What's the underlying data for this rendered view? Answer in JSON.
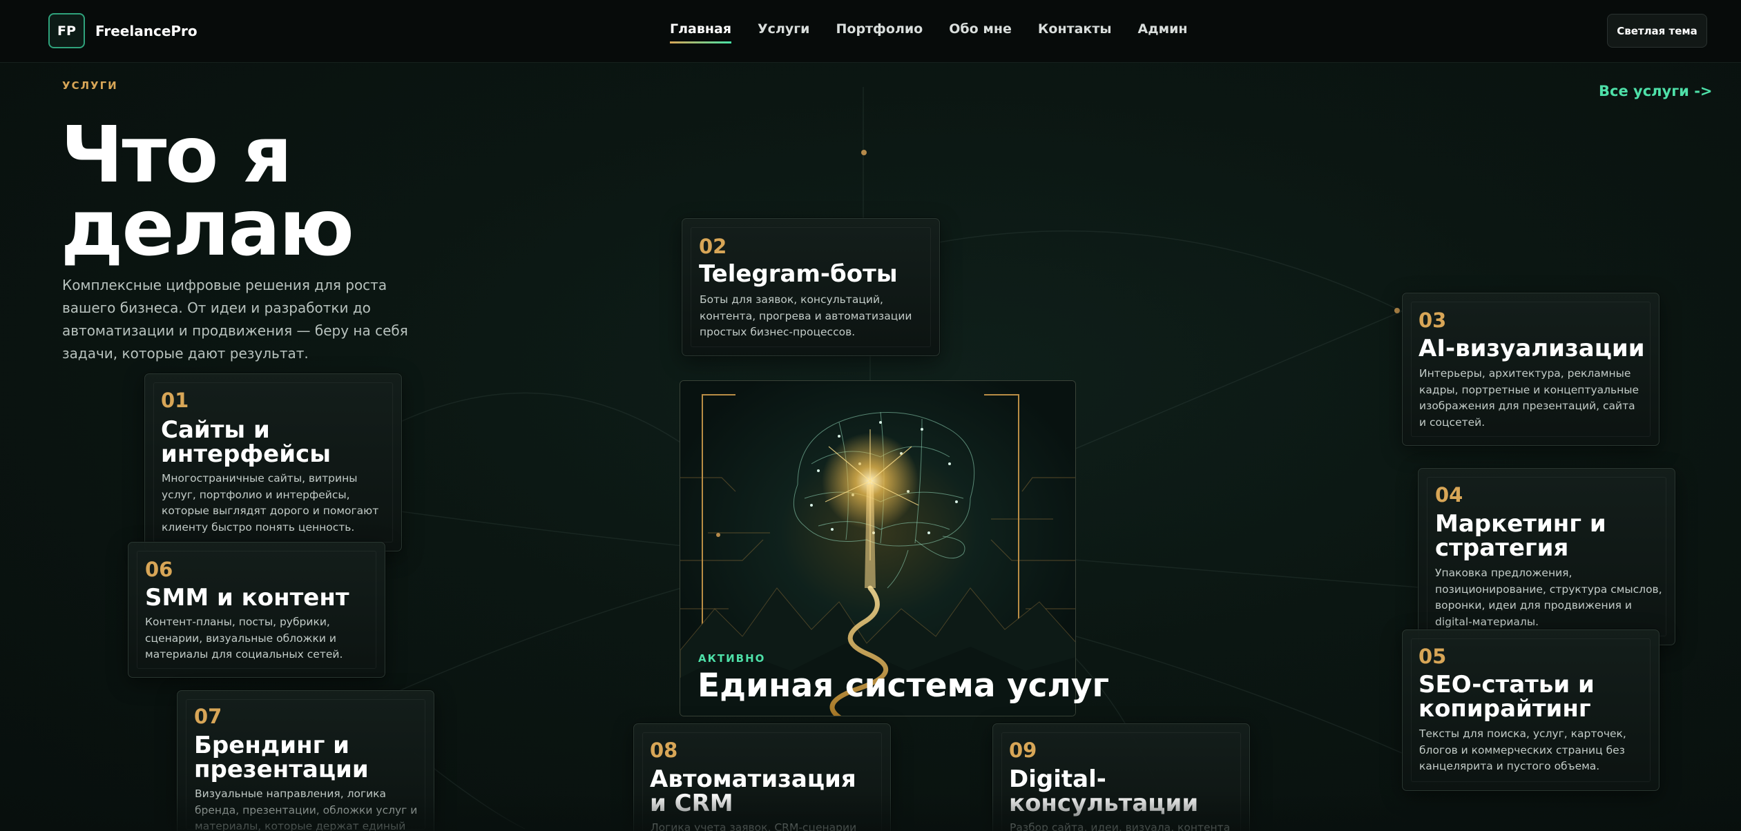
{
  "nav": {
    "logo": "FP",
    "brand": "FreelancePro",
    "links": [
      "Главная",
      "Услуги",
      "Портфолио",
      "Обо мне",
      "Контакты",
      "Админ"
    ],
    "theme_button": "Светлая тема"
  },
  "section": {
    "eyebrow": "УСЛУГИ",
    "all_link": "Все услуги ->",
    "title_line1": "Что я",
    "title_line2": "делаю",
    "description": "Комплексные цифровые решения для роста вашего бизнеса. От идеи и разработки до автоматизации и продвижения — беру на себя задачи, которые дают результат."
  },
  "center": {
    "label": "АКТИВНО",
    "title": "Единая система услуг"
  },
  "cards": [
    {
      "num": "01",
      "title": "Сайты и интерфейсы",
      "desc": "Многостраничные сайты, витрины услуг, портфолио и интерфейсы, которые выглядят дорого и помогают клиенту быстро понять ценность."
    },
    {
      "num": "02",
      "title": "Telegram-боты",
      "desc": "Боты для заявок, консультаций, контента, прогрева и автоматизации простых бизнес-процессов."
    },
    {
      "num": "03",
      "title": "AI-визуализации",
      "desc": "Интерьеры, архитектура, рекламные кадры, портретные и концептуальные изображения для презентаций, сайта и соцсетей."
    },
    {
      "num": "04",
      "title": "Маркетинг и стратегия",
      "desc": "Упаковка предложения, позиционирование, структура смыслов, воронки, идеи для продвижения и digital-материалы."
    },
    {
      "num": "05",
      "title": "SEO-статьи и копирайтинг",
      "desc": "Тексты для поиска, услуг, карточек, блогов и коммерческих страниц без канцелярита и пустого объема."
    },
    {
      "num": "06",
      "title": "SMM и контент",
      "desc": "Контент-планы, посты, рубрики, сценарии, визуальные обложки и материалы для социальных сетей."
    },
    {
      "num": "07",
      "title": "Брендинг и презентации",
      "desc": "Визуальные направления, логика бренда, презентации, обложки услуг и материалы, которые держат единый стиль."
    },
    {
      "num": "08",
      "title": "Автоматизация и CRM",
      "desc": "Логика учета заявок, CRM-сценарии"
    },
    {
      "num": "09",
      "title": "Digital-консультации",
      "desc": "Разбор сайта, идеи, визуала, контента или"
    }
  ]
}
